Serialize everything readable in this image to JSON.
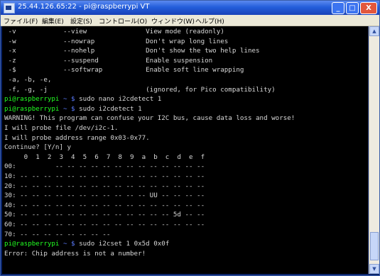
{
  "window": {
    "title": "25.44.126.65:22 - pi@raspberrypi  VT",
    "minimize": "_",
    "maximize": "□",
    "close": "X"
  },
  "menubar": [
    "ファイル(F)",
    "編集(E)",
    "設定(S)",
    "コントロール(O)",
    "ウィンドウ(W)",
    "ヘルプ(H)"
  ],
  "terminal": {
    "lines": [
      {
        "kind": "text",
        "text": " -v            --view               View mode (readonly)"
      },
      {
        "kind": "text",
        "text": " -w            --nowrap             Don't wrap long lines"
      },
      {
        "kind": "text",
        "text": " -x            --nohelp             Don't show the two help lines"
      },
      {
        "kind": "text",
        "text": " -z            --suspend            Enable suspension"
      },
      {
        "kind": "text",
        "text": " -$            --softwrap           Enable soft line wrapping"
      },
      {
        "kind": "text",
        "text": " -a, -b, -e,"
      },
      {
        "kind": "text",
        "text": " -f, -g, -j                         (ignored, for Pico compatibility)"
      },
      {
        "kind": "prompt",
        "user": "pi@raspberrypi",
        "path": " ~ $",
        "cmd": " sudo nano i2cdetect 1"
      },
      {
        "kind": "prompt",
        "user": "pi@raspberrypi",
        "path": " ~ $",
        "cmd": " sudo i2cdetect 1"
      },
      {
        "kind": "text",
        "text": "WARNING! This program can confuse your I2C bus, cause data loss and worse!"
      },
      {
        "kind": "text",
        "text": "I will probe file /dev/i2c-1."
      },
      {
        "kind": "text",
        "text": "I will probe address range 0x03-0x77."
      },
      {
        "kind": "text",
        "text": "Continue? [Y/n] y"
      },
      {
        "kind": "text",
        "text": "     0  1  2  3  4  5  6  7  8  9  a  b  c  d  e  f"
      },
      {
        "kind": "text",
        "text": "00:          -- -- -- -- -- -- -- -- -- -- -- -- --"
      },
      {
        "kind": "text",
        "text": "10: -- -- -- -- -- -- -- -- -- -- -- -- -- -- -- --"
      },
      {
        "kind": "text",
        "text": "20: -- -- -- -- -- -- -- -- -- -- -- -- -- -- -- --"
      },
      {
        "kind": "text",
        "text": "30: -- -- -- -- -- -- -- -- -- -- -- UU -- -- -- --"
      },
      {
        "kind": "text",
        "text": "40: -- -- -- -- -- -- -- -- -- -- -- -- -- -- -- --"
      },
      {
        "kind": "text",
        "text": "50: -- -- -- -- -- -- -- -- -- -- -- -- -- 5d -- --"
      },
      {
        "kind": "text",
        "text": "60: -- -- -- -- -- -- -- -- -- -- -- -- -- -- -- --"
      },
      {
        "kind": "text",
        "text": "70: -- -- -- -- -- -- -- --"
      },
      {
        "kind": "prompt",
        "user": "pi@raspberrypi",
        "path": " ~ $",
        "cmd": " sudo i2cset 1 0x5d 0x0f"
      },
      {
        "kind": "text",
        "text": "Error: Chip address is not a number!"
      }
    ]
  },
  "scrollbar": {
    "up": "▲",
    "down": "▼"
  }
}
